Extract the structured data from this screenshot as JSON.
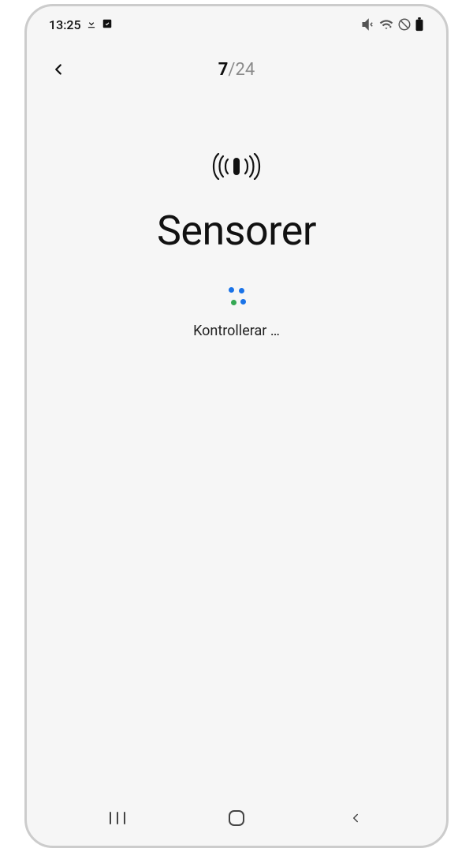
{
  "status_bar": {
    "time": "13:25"
  },
  "header": {
    "progress_current": "7",
    "progress_total": "/24"
  },
  "content": {
    "title": "Sensorer",
    "status_text": "Kontrollerar …"
  }
}
